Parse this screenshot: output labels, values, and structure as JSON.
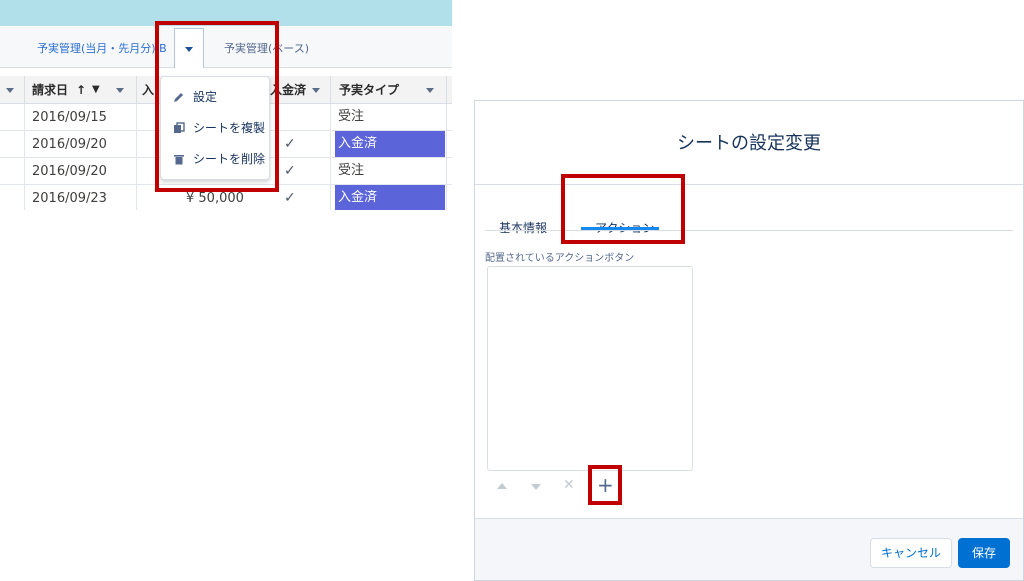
{
  "left": {
    "tabs": [
      "予実管理(当月・先月分) B",
      "予実管理(ベース)"
    ],
    "columns": [
      "請求日",
      "入",
      "入金済",
      "予実タイプ"
    ],
    "rows": [
      {
        "date": "2016/09/15",
        "amount": "",
        "checked": false,
        "type": "受注",
        "highlight": false
      },
      {
        "date": "2016/09/20",
        "amount": "",
        "checked": true,
        "type": "入金済",
        "highlight": true
      },
      {
        "date": "2016/09/20",
        "amount": "",
        "checked": true,
        "type": "受注",
        "highlight": false
      },
      {
        "date": "2016/09/23",
        "amount": "¥ 50,000",
        "checked": true,
        "type": "入金済",
        "highlight": true
      }
    ],
    "menu": [
      {
        "label": "設定",
        "icon": "pencil-icon"
      },
      {
        "label": "シートを複製",
        "icon": "copy-icon"
      },
      {
        "label": "シートを削除",
        "icon": "trash-icon"
      }
    ]
  },
  "modal": {
    "title": "シートの設定変更",
    "tabs": [
      "基本情報",
      "アクション"
    ],
    "active_tab": "アクション",
    "field_label": "配置されているアクションボタン",
    "cancel_label": "キャンセル",
    "save_label": "保存",
    "controls": [
      "move-up-icon",
      "move-down-icon",
      "remove-icon",
      "add-icon"
    ]
  },
  "colors": {
    "highlight_red": "#c00000",
    "paid_row": "#5b64d9",
    "primary": "#0070d2",
    "topbar": "#b1e0ea"
  }
}
